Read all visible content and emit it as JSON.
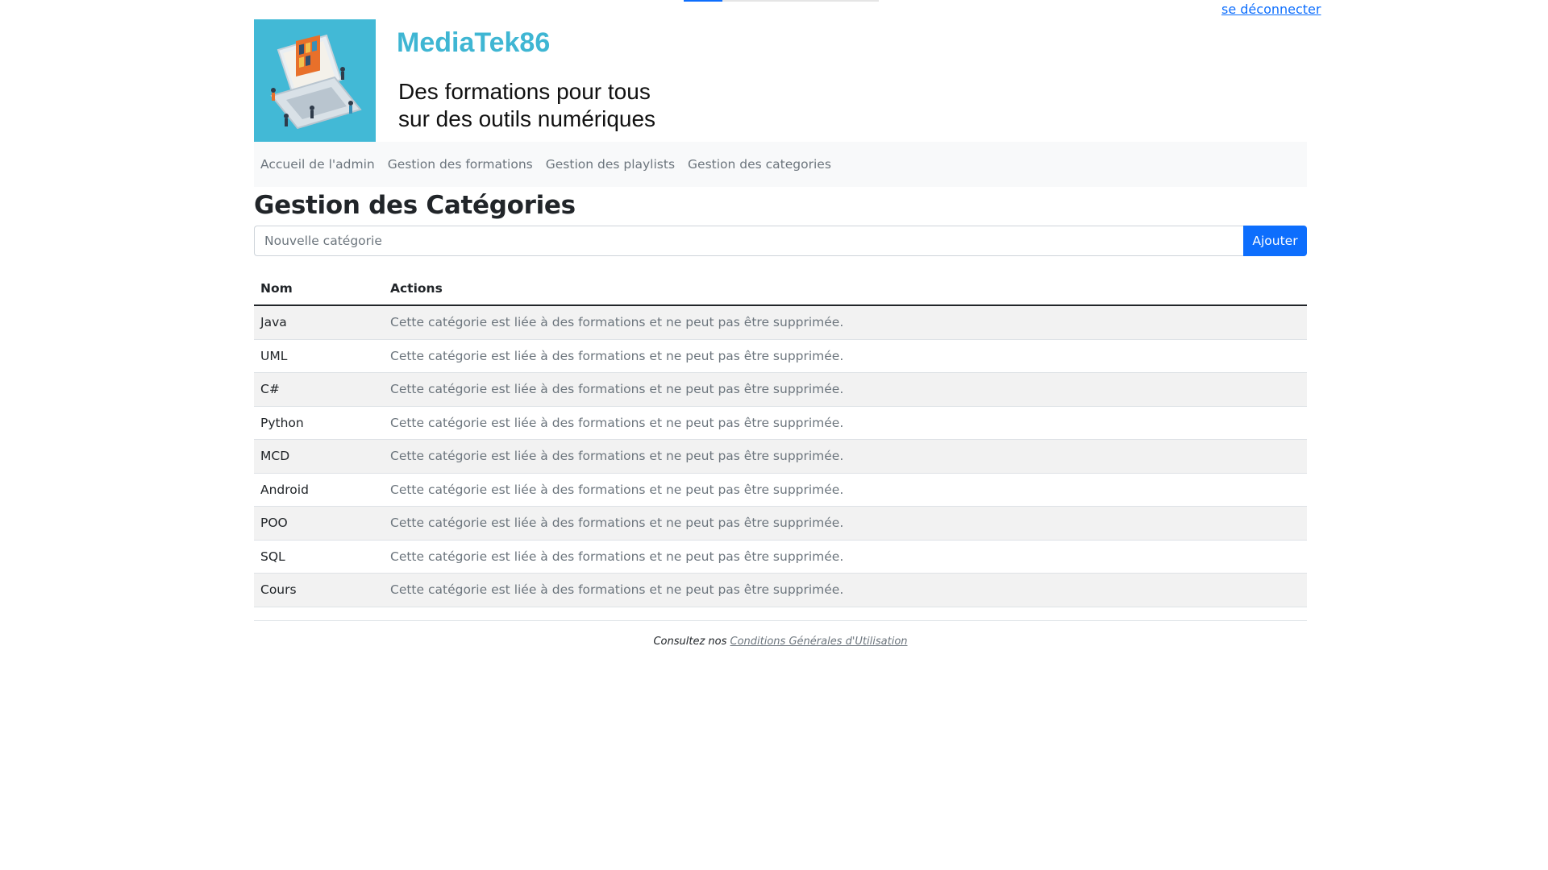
{
  "top": {
    "logout_label": "se déconnecter",
    "progress_fraction": 0.2
  },
  "header": {
    "brand": "MediaTek86",
    "tagline_line1": "Des formations pour tous",
    "tagline_line2": "sur des outils numériques"
  },
  "nav": {
    "items": [
      {
        "label": "Accueil de l'admin"
      },
      {
        "label": "Gestion des formations"
      },
      {
        "label": "Gestion des playlists"
      },
      {
        "label": "Gestion des categories"
      }
    ]
  },
  "main": {
    "title": "Gestion des Catégories",
    "input_placeholder": "Nouvelle catégorie",
    "add_button": "Ajouter",
    "table": {
      "headers": [
        "Nom",
        "Actions"
      ],
      "rows": [
        {
          "nom": "Java",
          "action": "Cette catégorie est liée à des formations et ne peut pas être supprimée."
        },
        {
          "nom": "UML",
          "action": "Cette catégorie est liée à des formations et ne peut pas être supprimée."
        },
        {
          "nom": "C#",
          "action": "Cette catégorie est liée à des formations et ne peut pas être supprimée."
        },
        {
          "nom": "Python",
          "action": "Cette catégorie est liée à des formations et ne peut pas être supprimée."
        },
        {
          "nom": "MCD",
          "action": "Cette catégorie est liée à des formations et ne peut pas être supprimée."
        },
        {
          "nom": "Android",
          "action": "Cette catégorie est liée à des formations et ne peut pas être supprimée."
        },
        {
          "nom": "POO",
          "action": "Cette catégorie est liée à des formations et ne peut pas être supprimée."
        },
        {
          "nom": "SQL",
          "action": "Cette catégorie est liée à des formations et ne peut pas être supprimée."
        },
        {
          "nom": "Cours",
          "action": "Cette catégorie est liée à des formations et ne peut pas être supprimée."
        }
      ]
    }
  },
  "footer": {
    "prefix": "Consultez nos",
    "link": "Conditions Générales d'Utilisation"
  },
  "colors": {
    "brand": "#3fb6d3",
    "primary": "#0d6efd",
    "logo_bg": "#42b9d6"
  },
  "icons": {
    "logo": "laptop-library-illustration"
  }
}
